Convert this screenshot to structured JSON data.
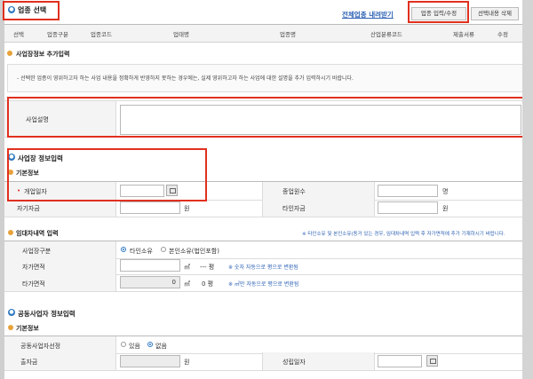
{
  "section_select": {
    "title": "업종 선택",
    "download_link": "전체업종 내려받기",
    "edit_button": "업종 입력/수정",
    "delete_all_button": "선택내용 삭제"
  },
  "table_headers": [
    "선택",
    "업종구분",
    "업종코드",
    "업태명",
    "업종명",
    "산업분류코드",
    "제출서류",
    "수정"
  ],
  "business_info": {
    "title": "사업장정보 추가입력",
    "notice": "- 선택한 업종이 영위하고자 하는 사업 내용을 정확하게 반영하지 못하는 경우에는, 실제 영위하고자 하는 사업에 대한 설명을 추가 입력하시기 바랍니다.",
    "desc_label": "사업설명",
    "desc_value": ""
  },
  "site_info": {
    "title": "사업장 정보입력",
    "basic": "기본정보"
  },
  "basic_fields": {
    "opening_date_label": "개업일자",
    "opening_date_value": "",
    "employee_count_label": "종업원수",
    "employee_unit": "명",
    "own_capital_label": "자기자금",
    "own_capital_unit": "원",
    "other_capital_label": "타인자금",
    "other_capital_unit": "원"
  },
  "lease": {
    "title": "임대차내역 입력",
    "notice": "※ 타인소유 및 본인소유(동거 있는 경우, 임대차내역 입력 후 자가면적에 추가 기재하시기 바랍니다.",
    "site_type_label": "사업장구분",
    "option_other": "타인소유",
    "option_own": "본인소유(법인포함)",
    "own_area_label": "자가면적",
    "area_unit": "㎡",
    "pyeong_dash": "--- 평",
    "own_area_note": "※ 숫자 자동으로 평으로 변환됨",
    "other_area_label": "타가면적",
    "other_area_value": "0",
    "other_pyeong": "0 평",
    "other_area_note": "※ ㎡만 자동으로 평으로 변환됨"
  },
  "partner": {
    "title": "공동사업자 정보입력",
    "basic": "기본정보",
    "select_label": "공동사업자선정",
    "opt_yes": "있음",
    "opt_no": "없음",
    "investment_label": "출자금",
    "investment_unit": "원",
    "date_label": "성립일자"
  }
}
